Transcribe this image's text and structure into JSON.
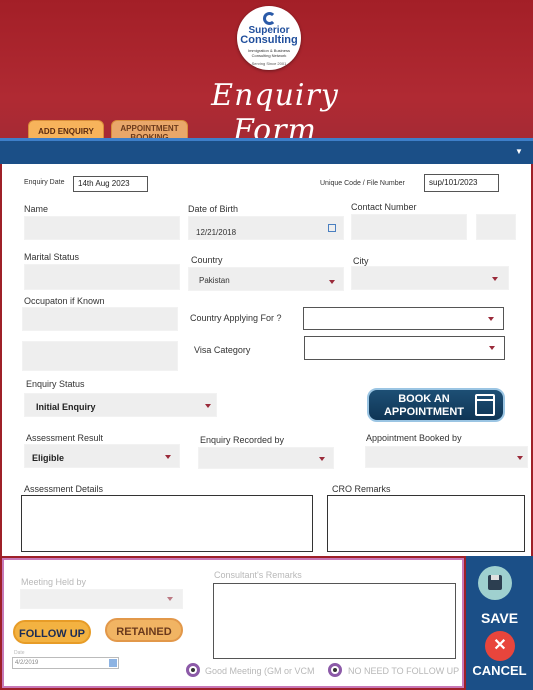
{
  "logo": {
    "line1": "Superior",
    "line2": "Consulting",
    "line3": "Immigration & Business Consulting Network",
    "line4": "Serving Since 2001"
  },
  "page_title": "Enquiry Form",
  "tabs": [
    {
      "label": "ADD ENQUIRY"
    },
    {
      "label_line1": "APPOINTMENT",
      "label_line2": "BOOKING"
    }
  ],
  "form": {
    "enquiry_date_label": "Enquiry Date",
    "enquiry_date_value": "14th Aug 2023",
    "unique_code_label": "Unique Code / File Number",
    "unique_code_value": "sup/101/2023",
    "name_label": "Name",
    "dob_label": "Date of Birth",
    "dob_value": "12/21/2018",
    "contact_label": "Contact Number",
    "marital_label": "Marital Status",
    "country_label": "Country",
    "country_value": "Pakistan",
    "city_label": "City",
    "occupation_label": "Occupaton if Known",
    "country_applying_label": "Country Applying For ?",
    "visa_label": "Visa Category",
    "enquiry_status_label": "Enquiry Status",
    "enquiry_status_value": "Initial Enquiry",
    "book_line1": "BOOK AN",
    "book_line2": "APPOINTMENT",
    "assessment_result_label": "Assessment Result",
    "assessment_result_value": "Eligible",
    "enquiry_recorded_label": "Enquiry Recorded by",
    "appointment_booked_label": "Appointment Booked by",
    "assessment_details_label": "Assessment Details",
    "cro_remarks_label": "CRO Remarks"
  },
  "bottom": {
    "meeting_held_label": "Meeting Held by",
    "consultant_remarks_label": "Consultant's Remarks",
    "follow_up_label": "FOLLOW UP",
    "retained_label": "RETAINED",
    "date_label": "Date",
    "date_value": "4/2/2019",
    "radio1_label": "Good Meeting (GM or VCM",
    "radio2_label": "NO NEED TO FOLLOW UP"
  },
  "sidebar": {
    "save_label": "SAVE",
    "cancel_label": "CANCEL"
  },
  "colors": {
    "header_red": "#a31f27",
    "nav_blue": "#1b4f87",
    "tab_orange": "#f7b35b",
    "arrow": "#9a2a3a",
    "accent_purple": "#c779b8"
  }
}
